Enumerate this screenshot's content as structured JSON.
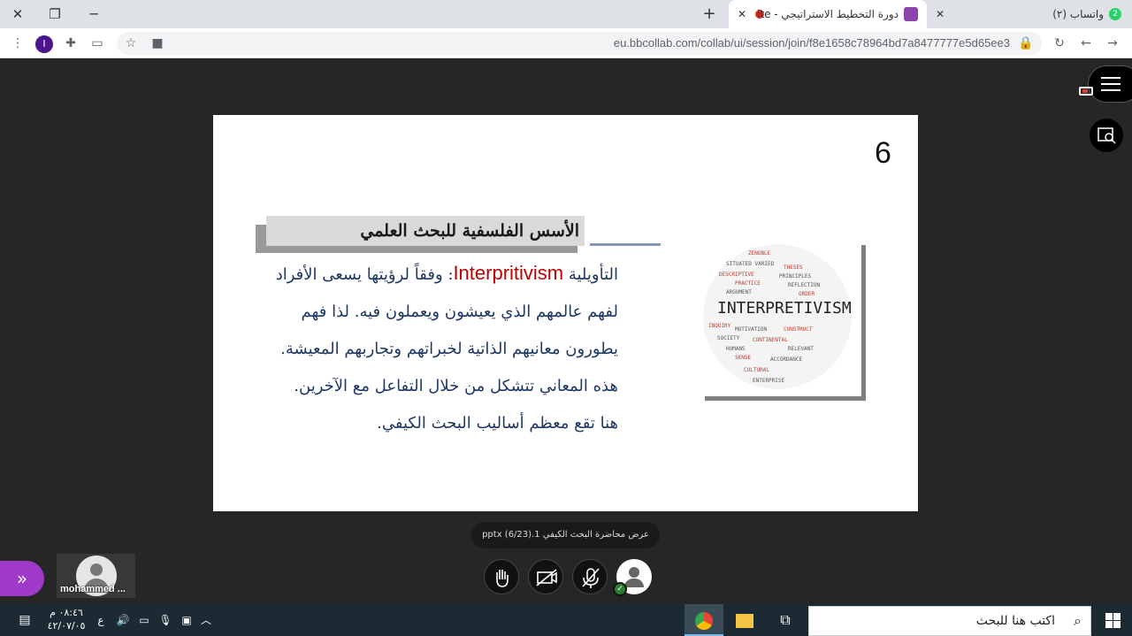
{
  "browser": {
    "tabs": [
      {
        "title": "واتساب (٢)",
        "badge": "2",
        "active": false
      },
      {
        "title": "دورة التخطيط الاستراتيجي - ite",
        "active": true
      }
    ],
    "url": "eu.bbcollab.com/collab/ui/session/join/f8e1658c78964bd7a8477777e5d65ee3",
    "profile_initial": "I"
  },
  "slide": {
    "number": "6",
    "title": "الأسس الفلسفية للبحث العلمي",
    "lines": [
      {
        "prefix": "التأويلية ",
        "highlight": "Interpritivism",
        "rest": ": وفقاً لرؤيتها يسعى الأفراد"
      },
      {
        "text": "لفهم عالمهم الذي يعيشون ويعملون فيه. لذا فهم"
      },
      {
        "text": "يطورون معانيهم الذاتية لخبراتهم وتجاربهم المعيشة."
      },
      {
        "text": "هذه المعاني تتشكل من خلال التفاعل مع الآخرين."
      },
      {
        "text": "هنا تقع معظم أساليب البحث الكيفي."
      }
    ],
    "wordcloud_main": "INTERPRETIVISM"
  },
  "caption": "عرض محاضرة البحث الكيفي 1.pptx (6/23)",
  "participant": {
    "name": "mohammed ..."
  },
  "taskbar": {
    "search_placeholder": "اكتب هنا للبحث",
    "time": "٠٨:٤٦ م",
    "date": "٤٢/٠٧/٠٥",
    "lang": "ع"
  },
  "colors": {
    "accent": "#a03ac9",
    "highlight": "#c00000",
    "text": "#1f3864"
  }
}
